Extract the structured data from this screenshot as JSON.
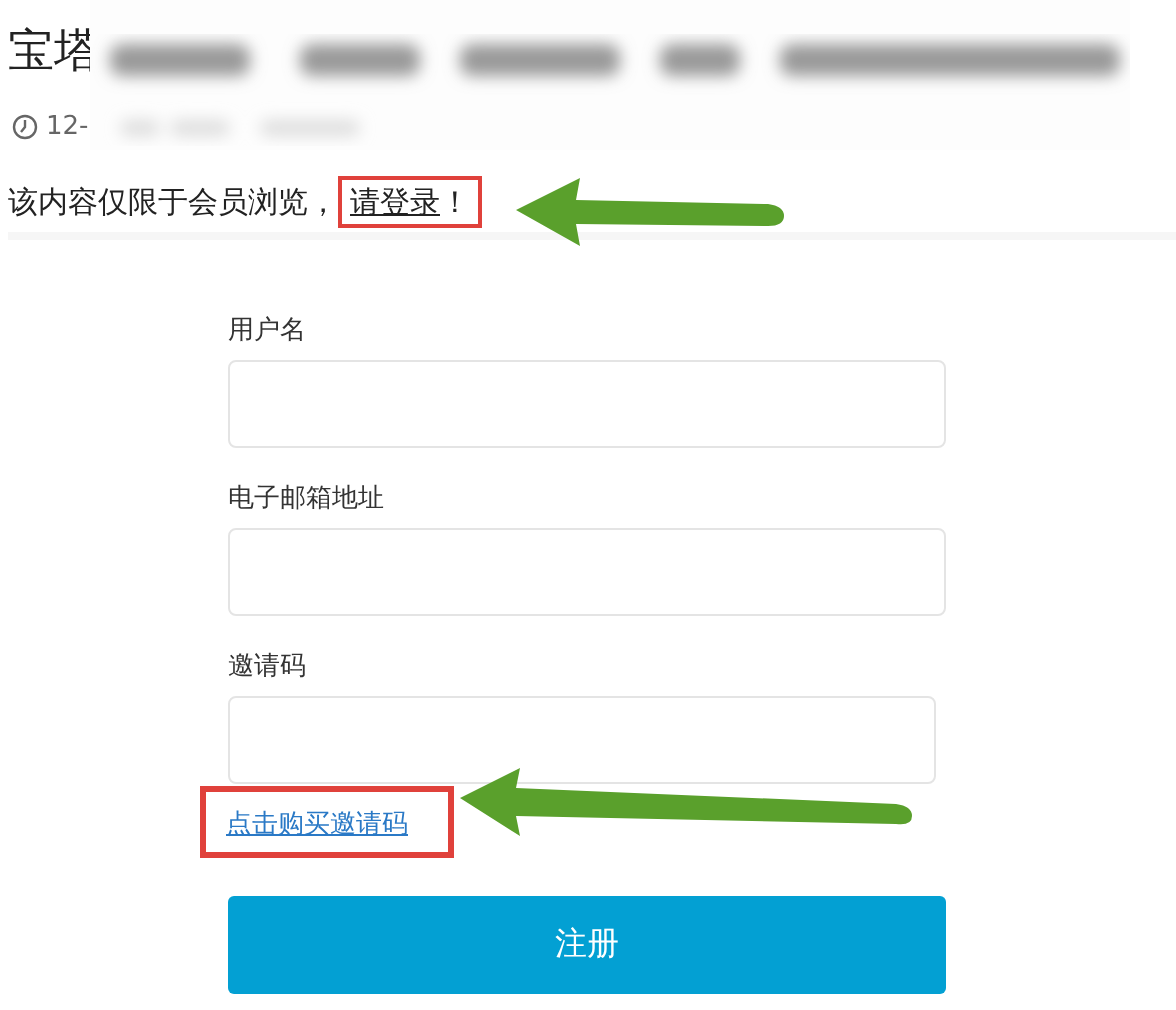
{
  "header": {
    "title": "宝塔",
    "date": "12-"
  },
  "notice": {
    "text": "该内容仅限于会员浏览，",
    "link": "请登录",
    "suffix": "！"
  },
  "form": {
    "fields": [
      {
        "label": "用户名"
      },
      {
        "label": "电子邮箱地址"
      },
      {
        "label": "邀请码"
      }
    ],
    "link": "点击购买邀请码",
    "submit": "注册"
  }
}
